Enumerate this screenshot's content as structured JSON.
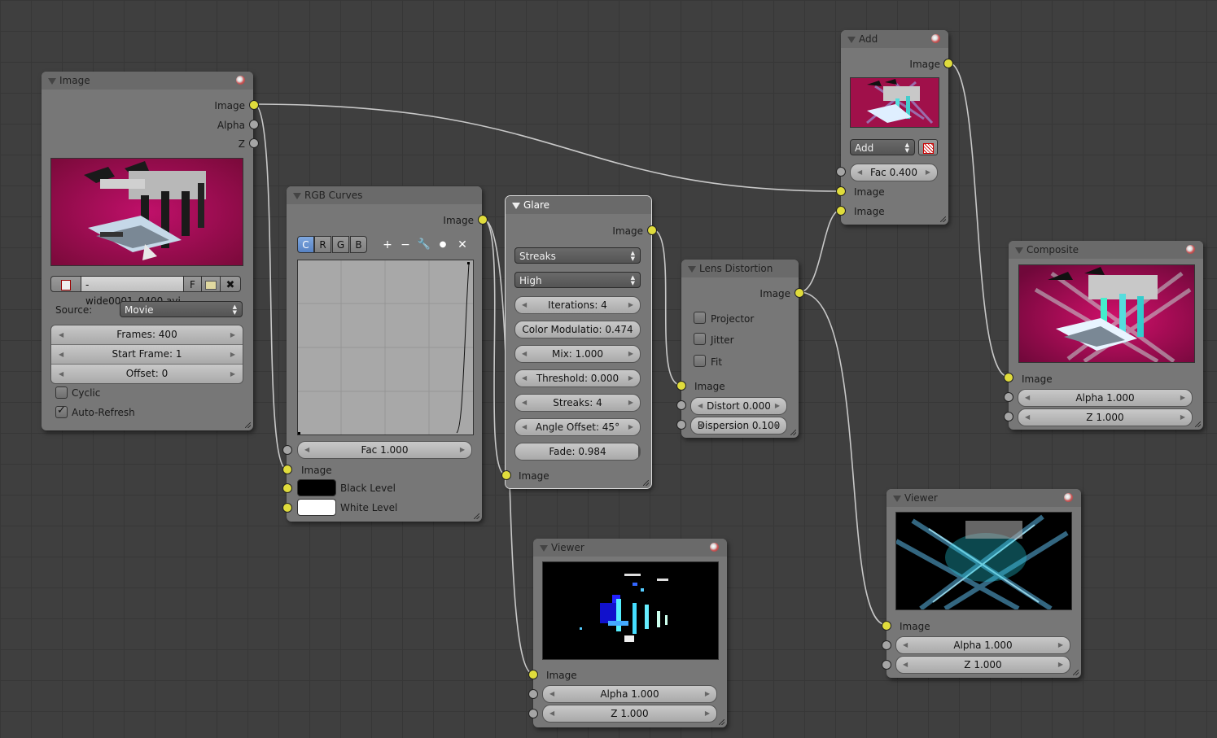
{
  "image_node": {
    "title": "Image",
    "outputs": [
      "Image",
      "Alpha",
      "Z"
    ],
    "filename": "-wide0001_0400.avi",
    "f_button": "F",
    "source_label": "Source:",
    "source_value": "Movie",
    "frames": "Frames: 400",
    "start_frame": "Start Frame: 1",
    "offset": "Offset: 0",
    "cyclic": "Cyclic",
    "cyclic_checked": false,
    "auto_refresh": "Auto-Refresh",
    "auto_refresh_checked": true
  },
  "rgb_curves_node": {
    "title": "RGB Curves",
    "output": "Image",
    "channels": [
      "C",
      "R",
      "G",
      "B"
    ],
    "active_channel": "C",
    "fac": "Fac 1.000",
    "input_image": "Image",
    "black_level": "Black Level",
    "white_level": "White Level"
  },
  "glare_node": {
    "title": "Glare",
    "output": "Image",
    "glare_type": "Streaks",
    "quality": "High",
    "iterations": "Iterations: 4",
    "color_modulation": "Color Modulatio: 0.474",
    "mix": "Mix: 1.000",
    "threshold": "Threshold: 0.000",
    "streaks": "Streaks: 4",
    "angle_offset": "Angle Offset: 45°",
    "fade": "Fade: 0.984",
    "fade_value": 0.984,
    "input_image": "Image"
  },
  "lens_node": {
    "title": "Lens Distortion",
    "output": "Image",
    "projector": "Projector",
    "jitter": "Jitter",
    "fit": "Fit",
    "input_image": "Image",
    "distort": "Distort 0.000",
    "dispersion": "Dispersion 0.100"
  },
  "add_node": {
    "title": "Add",
    "output": "Image",
    "blend_mode": "Add",
    "fac": "Fac 0.400",
    "input1": "Image",
    "input2": "Image"
  },
  "composite_node": {
    "title": "Composite",
    "input_image": "Image",
    "alpha": "Alpha 1.000",
    "z": "Z 1.000"
  },
  "viewer1_node": {
    "title": "Viewer",
    "input_image": "Image",
    "alpha": "Alpha 1.000",
    "z": "Z 1.000"
  },
  "viewer2_node": {
    "title": "Viewer",
    "input_image": "Image",
    "alpha": "Alpha 1.000",
    "z": "Z 1.000"
  },
  "colors": {
    "socket_image": "#e0dc3c",
    "socket_value": "#a5a5a5",
    "node_body": "#777777",
    "node_header": "#6a6a6a",
    "background": "#3f3f3f",
    "active_channel": "#5682c4"
  }
}
